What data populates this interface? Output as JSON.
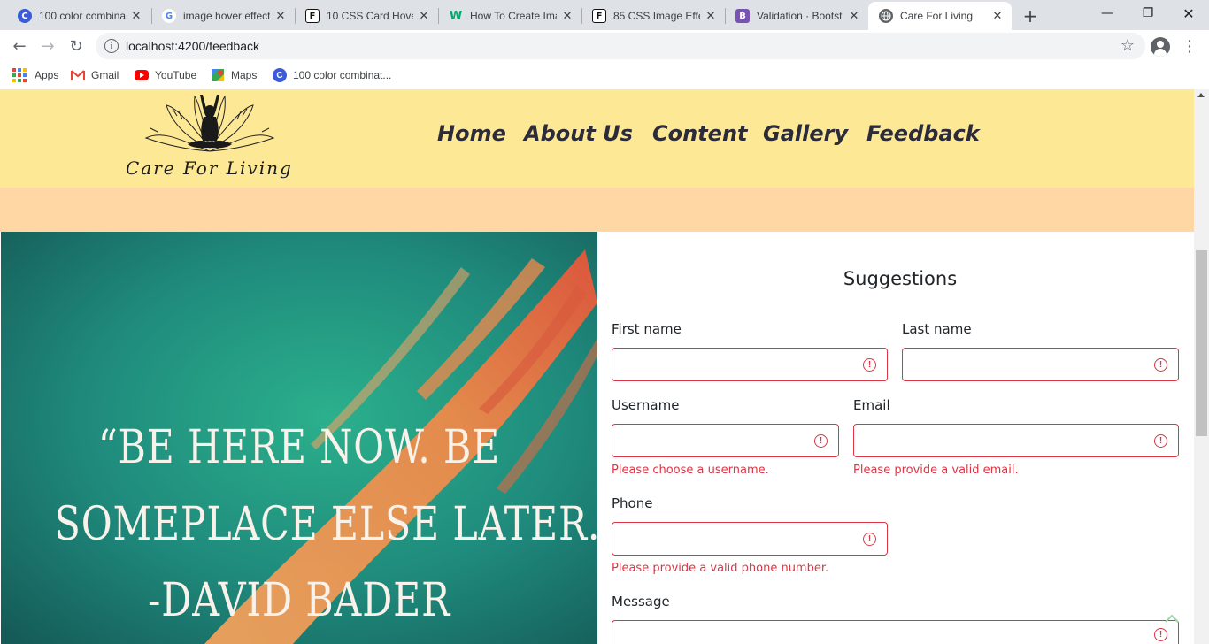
{
  "browser": {
    "tabs": [
      {
        "title": "100 color combina",
        "favicon": "C",
        "favicon_color": "#3b5bdb"
      },
      {
        "title": "image hover effect",
        "favicon": "G",
        "favicon_color": "#ffffff"
      },
      {
        "title": "10 CSS Card Hover",
        "favicon": "F",
        "favicon_color": "#111111"
      },
      {
        "title": "How To Create Ima",
        "favicon": "W",
        "favicon_color": "#04aa6d"
      },
      {
        "title": "85 CSS Image Effe",
        "favicon": "F",
        "favicon_color": "#111111"
      },
      {
        "title": "Validation · Bootst",
        "favicon": "B",
        "favicon_color": "#7952b3"
      },
      {
        "title": "Care For Living",
        "favicon": "globe",
        "favicon_color": "#5f6368"
      }
    ],
    "url": "localhost:4200/feedback",
    "bookmarks": [
      {
        "label": "Apps",
        "icon": "apps-grid-icon"
      },
      {
        "label": "Gmail",
        "icon": "gmail-icon"
      },
      {
        "label": "YouTube",
        "icon": "youtube-icon"
      },
      {
        "label": "Maps",
        "icon": "maps-icon"
      },
      {
        "label": "100 color combinat...",
        "icon": "c-icon"
      }
    ]
  },
  "site": {
    "logo_text": "Care For Living",
    "nav": [
      "Home",
      "About Us",
      "Content",
      "Gallery",
      "Feedback"
    ],
    "header_bg": "#fde896",
    "band_bg": "#fed7a5"
  },
  "hero": {
    "quote_lines": [
      "“BE HERE NOW. BE",
      "SOMEPLACE ELSE LATER.”",
      "-DAVID BADER"
    ]
  },
  "form": {
    "title": "Suggestions",
    "first_name_label": "First name",
    "last_name_label": "Last name",
    "username_label": "Username",
    "email_label": "Email",
    "phone_label": "Phone",
    "message_label": "Message",
    "username_feedback": "Please choose a username.",
    "email_feedback": "Please provide a valid email.",
    "phone_feedback": "Please provide a valid phone number.",
    "error_color": "#dc3545"
  }
}
